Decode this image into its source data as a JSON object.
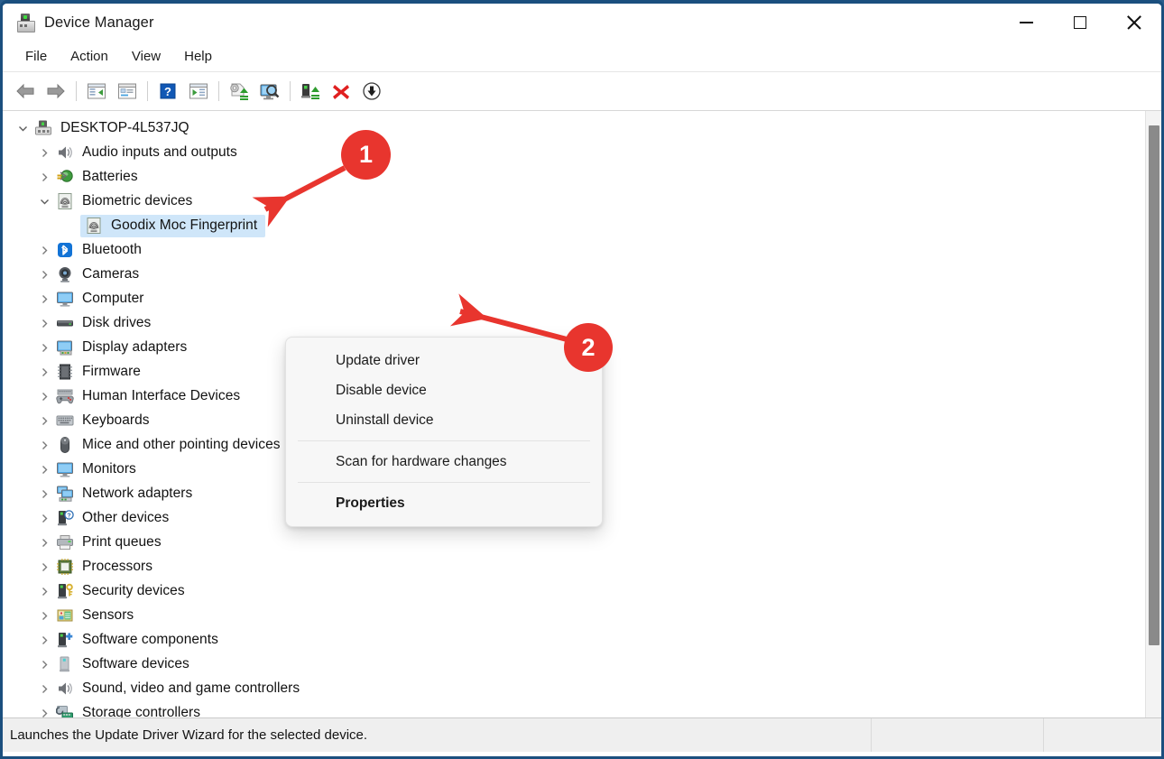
{
  "window": {
    "title": "Device Manager",
    "icon": "device-manager-icon",
    "controls": {
      "minimize": "Minimize",
      "maximize": "Maximize",
      "close": "Close"
    }
  },
  "menubar": {
    "items": [
      {
        "label": "File",
        "name": "menu-file"
      },
      {
        "label": "Action",
        "name": "menu-action"
      },
      {
        "label": "View",
        "name": "menu-view"
      },
      {
        "label": "Help",
        "name": "menu-help"
      }
    ]
  },
  "toolbar": {
    "buttons": [
      {
        "name": "back-button",
        "icon": "back-arrow-icon",
        "title": "Back"
      },
      {
        "name": "forward-button",
        "icon": "forward-arrow-icon",
        "title": "Forward"
      },
      {
        "name": "show-hide-console-tree-button",
        "icon": "console-tree-icon",
        "title": "Show/Hide Console Tree"
      },
      {
        "name": "properties-button",
        "icon": "properties-window-icon",
        "title": "Properties"
      },
      {
        "name": "help-button",
        "icon": "help-question-icon",
        "title": "Help"
      },
      {
        "name": "show-hide-action-pane-button",
        "icon": "action-pane-icon",
        "title": "Show/Hide Action Pane"
      },
      {
        "name": "update-driver-button",
        "icon": "update-driver-icon",
        "title": "Update driver"
      },
      {
        "name": "scan-hardware-changes-button",
        "icon": "scan-monitor-icon",
        "title": "Scan for hardware changes"
      },
      {
        "name": "enable-device-button",
        "icon": "enable-device-icon",
        "title": "Enable device"
      },
      {
        "name": "uninstall-device-button",
        "icon": "red-x-icon",
        "title": "Uninstall device"
      },
      {
        "name": "disable-device-button",
        "icon": "down-arrow-circle-icon",
        "title": "Disable device"
      }
    ]
  },
  "tree": {
    "nodes": [
      {
        "label": "DESKTOP-4L537JQ",
        "icon": "computer-device-icon",
        "level": 0,
        "state": "expanded",
        "selected": false
      },
      {
        "label": "Audio inputs and outputs",
        "icon": "speaker-icon",
        "level": 1,
        "state": "collapsed",
        "selected": false
      },
      {
        "label": "Batteries",
        "icon": "battery-icon",
        "level": 1,
        "state": "collapsed",
        "selected": false
      },
      {
        "label": "Biometric devices",
        "icon": "fingerprint-icon",
        "level": 1,
        "state": "expanded",
        "selected": false
      },
      {
        "label": "Goodix Moc Fingerprint",
        "icon": "fingerprint-icon",
        "level": 2,
        "state": "leaf",
        "selected": true
      },
      {
        "label": "Bluetooth",
        "icon": "bluetooth-icon",
        "level": 1,
        "state": "collapsed",
        "selected": false
      },
      {
        "label": "Cameras",
        "icon": "camera-icon",
        "level": 1,
        "state": "collapsed",
        "selected": false
      },
      {
        "label": "Computer",
        "icon": "monitor-icon",
        "level": 1,
        "state": "collapsed",
        "selected": false
      },
      {
        "label": "Disk drives",
        "icon": "disk-drive-icon",
        "level": 1,
        "state": "collapsed",
        "selected": false
      },
      {
        "label": "Display adapters",
        "icon": "display-adapter-icon",
        "level": 1,
        "state": "collapsed",
        "selected": false
      },
      {
        "label": "Firmware",
        "icon": "firmware-chip-icon",
        "level": 1,
        "state": "collapsed",
        "selected": false
      },
      {
        "label": "Human Interface Devices",
        "icon": "hid-gamepad-icon",
        "level": 1,
        "state": "collapsed",
        "selected": false
      },
      {
        "label": "Keyboards",
        "icon": "keyboard-icon",
        "level": 1,
        "state": "collapsed",
        "selected": false
      },
      {
        "label": "Mice and other pointing devices",
        "icon": "mouse-icon",
        "level": 1,
        "state": "collapsed",
        "selected": false
      },
      {
        "label": "Monitors",
        "icon": "monitor-icon",
        "level": 1,
        "state": "collapsed",
        "selected": false
      },
      {
        "label": "Network adapters",
        "icon": "network-adapter-icon",
        "level": 1,
        "state": "collapsed",
        "selected": false
      },
      {
        "label": "Other devices",
        "icon": "other-device-question-icon",
        "level": 1,
        "state": "collapsed",
        "selected": false
      },
      {
        "label": "Print queues",
        "icon": "printer-icon",
        "level": 1,
        "state": "collapsed",
        "selected": false
      },
      {
        "label": "Processors",
        "icon": "processor-chip-icon",
        "level": 1,
        "state": "collapsed",
        "selected": false
      },
      {
        "label": "Security devices",
        "icon": "security-key-icon",
        "level": 1,
        "state": "collapsed",
        "selected": false
      },
      {
        "label": "Sensors",
        "icon": "sensors-icon",
        "level": 1,
        "state": "collapsed",
        "selected": false
      },
      {
        "label": "Software components",
        "icon": "software-component-icon",
        "level": 1,
        "state": "collapsed",
        "selected": false
      },
      {
        "label": "Software devices",
        "icon": "software-device-icon",
        "level": 1,
        "state": "collapsed",
        "selected": false
      },
      {
        "label": "Sound, video and game controllers",
        "icon": "speaker-icon",
        "level": 1,
        "state": "collapsed",
        "selected": false
      },
      {
        "label": "Storage controllers",
        "icon": "storage-controller-icon",
        "level": 1,
        "state": "collapsed",
        "selected": false
      }
    ]
  },
  "context_menu": {
    "items": [
      {
        "label": "Update driver",
        "name": "ctx-update-driver",
        "bold": false,
        "separator_after": false
      },
      {
        "label": "Disable device",
        "name": "ctx-disable-device",
        "bold": false,
        "separator_after": false
      },
      {
        "label": "Uninstall device",
        "name": "ctx-uninstall-device",
        "bold": false,
        "separator_after": true
      },
      {
        "label": "Scan for hardware changes",
        "name": "ctx-scan-hardware-changes",
        "bold": false,
        "separator_after": true
      },
      {
        "label": "Properties",
        "name": "ctx-properties",
        "bold": true,
        "separator_after": false
      }
    ]
  },
  "statusbar": {
    "message": "Launches the Update Driver Wizard for the selected device."
  },
  "annotations": [
    {
      "label": "1",
      "name": "annotation-badge-1",
      "points_to": "Goodix Moc Fingerprint"
    },
    {
      "label": "2",
      "name": "annotation-badge-2",
      "points_to": "Uninstall device"
    }
  ],
  "colors": {
    "accent_annotation": "#e8352e",
    "selection": "#cfe6f9",
    "window_border": "#1b4f7e",
    "statusbar_bg": "#efefef"
  }
}
